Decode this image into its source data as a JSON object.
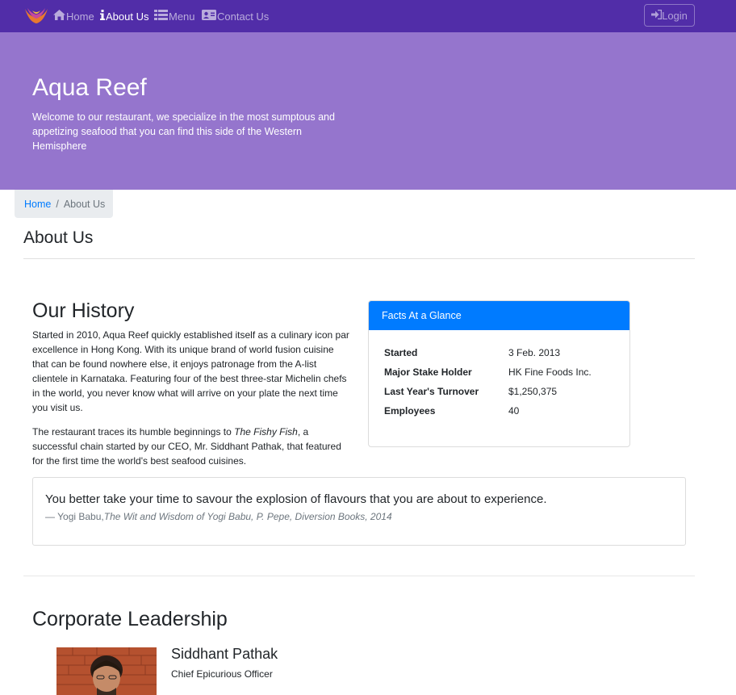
{
  "nav": {
    "items": [
      {
        "label": "Home",
        "icon": "home-icon"
      },
      {
        "label": "About Us",
        "icon": "info-icon"
      },
      {
        "label": "Menu",
        "icon": "list-icon"
      },
      {
        "label": "Contact Us",
        "icon": "address-card-icon"
      }
    ],
    "login_label": "Login",
    "colors": {
      "navbar": "#512da8",
      "jumbotron": "#9575cd",
      "card_header": "#007bff"
    }
  },
  "jumbotron": {
    "title": "Aqua Reef",
    "text": "Welcome to our restaurant, we specialize in the most sumptous and appetizing seafood that you can find this side of the Western Hemisphere"
  },
  "breadcrumb": {
    "home": "Home",
    "current": "About Us"
  },
  "page_title": "About Us",
  "history": {
    "title": "Our History",
    "p1": "Started in 2010, Aqua Reef quickly established itself as a culinary icon par excellence in Hong Kong. With its unique brand of world fusion cuisine that can be found nowhere else, it enjoys patronage from the A-list clientele in Karnataka. Featuring four of the best three-star Michelin chefs in the world, you never know what will arrive on your plate the next time you visit us.",
    "p2_before": "The restaurant traces its humble beginnings to ",
    "p2_italic": "The Fishy Fish",
    "p2_after": ", a successful chain started by our CEO, Mr. Siddhant Pathak, that featured for the first time the world's best seafood cuisines."
  },
  "facts": {
    "header": "Facts At a Glance",
    "rows": [
      {
        "label": "Started",
        "value": "3 Feb. 2013"
      },
      {
        "label": "Major Stake Holder",
        "value": "HK Fine Foods Inc."
      },
      {
        "label": "Last Year's Turnover",
        "value": "$1,250,375"
      },
      {
        "label": "Employees",
        "value": "40"
      }
    ]
  },
  "quote": {
    "text": "You better take your time to savour the explosion of flavours that you are about to experience.",
    "author_prefix": "— Yogi Babu,",
    "source": "The Wit and Wisdom of Yogi Babu, P. Pepe, Diversion Books, 2014"
  },
  "leadership": {
    "title": "Corporate Leadership",
    "leaders": [
      {
        "name": "Siddhant Pathak",
        "role": "Chief Epicurious Officer"
      }
    ]
  }
}
